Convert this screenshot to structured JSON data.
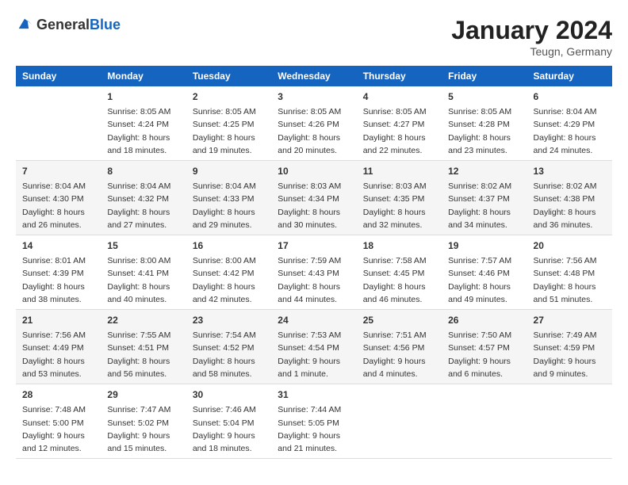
{
  "header": {
    "logo_general": "General",
    "logo_blue": "Blue",
    "title": "January 2024",
    "subtitle": "Teugn, Germany"
  },
  "calendar": {
    "days_of_week": [
      "Sunday",
      "Monday",
      "Tuesday",
      "Wednesday",
      "Thursday",
      "Friday",
      "Saturday"
    ],
    "weeks": [
      [
        {
          "day": "",
          "info": ""
        },
        {
          "day": "1",
          "info": "Sunrise: 8:05 AM\nSunset: 4:24 PM\nDaylight: 8 hours\nand 18 minutes."
        },
        {
          "day": "2",
          "info": "Sunrise: 8:05 AM\nSunset: 4:25 PM\nDaylight: 8 hours\nand 19 minutes."
        },
        {
          "day": "3",
          "info": "Sunrise: 8:05 AM\nSunset: 4:26 PM\nDaylight: 8 hours\nand 20 minutes."
        },
        {
          "day": "4",
          "info": "Sunrise: 8:05 AM\nSunset: 4:27 PM\nDaylight: 8 hours\nand 22 minutes."
        },
        {
          "day": "5",
          "info": "Sunrise: 8:05 AM\nSunset: 4:28 PM\nDaylight: 8 hours\nand 23 minutes."
        },
        {
          "day": "6",
          "info": "Sunrise: 8:04 AM\nSunset: 4:29 PM\nDaylight: 8 hours\nand 24 minutes."
        }
      ],
      [
        {
          "day": "7",
          "info": "Sunrise: 8:04 AM\nSunset: 4:30 PM\nDaylight: 8 hours\nand 26 minutes."
        },
        {
          "day": "8",
          "info": "Sunrise: 8:04 AM\nSunset: 4:32 PM\nDaylight: 8 hours\nand 27 minutes."
        },
        {
          "day": "9",
          "info": "Sunrise: 8:04 AM\nSunset: 4:33 PM\nDaylight: 8 hours\nand 29 minutes."
        },
        {
          "day": "10",
          "info": "Sunrise: 8:03 AM\nSunset: 4:34 PM\nDaylight: 8 hours\nand 30 minutes."
        },
        {
          "day": "11",
          "info": "Sunrise: 8:03 AM\nSunset: 4:35 PM\nDaylight: 8 hours\nand 32 minutes."
        },
        {
          "day": "12",
          "info": "Sunrise: 8:02 AM\nSunset: 4:37 PM\nDaylight: 8 hours\nand 34 minutes."
        },
        {
          "day": "13",
          "info": "Sunrise: 8:02 AM\nSunset: 4:38 PM\nDaylight: 8 hours\nand 36 minutes."
        }
      ],
      [
        {
          "day": "14",
          "info": "Sunrise: 8:01 AM\nSunset: 4:39 PM\nDaylight: 8 hours\nand 38 minutes."
        },
        {
          "day": "15",
          "info": "Sunrise: 8:00 AM\nSunset: 4:41 PM\nDaylight: 8 hours\nand 40 minutes."
        },
        {
          "day": "16",
          "info": "Sunrise: 8:00 AM\nSunset: 4:42 PM\nDaylight: 8 hours\nand 42 minutes."
        },
        {
          "day": "17",
          "info": "Sunrise: 7:59 AM\nSunset: 4:43 PM\nDaylight: 8 hours\nand 44 minutes."
        },
        {
          "day": "18",
          "info": "Sunrise: 7:58 AM\nSunset: 4:45 PM\nDaylight: 8 hours\nand 46 minutes."
        },
        {
          "day": "19",
          "info": "Sunrise: 7:57 AM\nSunset: 4:46 PM\nDaylight: 8 hours\nand 49 minutes."
        },
        {
          "day": "20",
          "info": "Sunrise: 7:56 AM\nSunset: 4:48 PM\nDaylight: 8 hours\nand 51 minutes."
        }
      ],
      [
        {
          "day": "21",
          "info": "Sunrise: 7:56 AM\nSunset: 4:49 PM\nDaylight: 8 hours\nand 53 minutes."
        },
        {
          "day": "22",
          "info": "Sunrise: 7:55 AM\nSunset: 4:51 PM\nDaylight: 8 hours\nand 56 minutes."
        },
        {
          "day": "23",
          "info": "Sunrise: 7:54 AM\nSunset: 4:52 PM\nDaylight: 8 hours\nand 58 minutes."
        },
        {
          "day": "24",
          "info": "Sunrise: 7:53 AM\nSunset: 4:54 PM\nDaylight: 9 hours\nand 1 minute."
        },
        {
          "day": "25",
          "info": "Sunrise: 7:51 AM\nSunset: 4:56 PM\nDaylight: 9 hours\nand 4 minutes."
        },
        {
          "day": "26",
          "info": "Sunrise: 7:50 AM\nSunset: 4:57 PM\nDaylight: 9 hours\nand 6 minutes."
        },
        {
          "day": "27",
          "info": "Sunrise: 7:49 AM\nSunset: 4:59 PM\nDaylight: 9 hours\nand 9 minutes."
        }
      ],
      [
        {
          "day": "28",
          "info": "Sunrise: 7:48 AM\nSunset: 5:00 PM\nDaylight: 9 hours\nand 12 minutes."
        },
        {
          "day": "29",
          "info": "Sunrise: 7:47 AM\nSunset: 5:02 PM\nDaylight: 9 hours\nand 15 minutes."
        },
        {
          "day": "30",
          "info": "Sunrise: 7:46 AM\nSunset: 5:04 PM\nDaylight: 9 hours\nand 18 minutes."
        },
        {
          "day": "31",
          "info": "Sunrise: 7:44 AM\nSunset: 5:05 PM\nDaylight: 9 hours\nand 21 minutes."
        },
        {
          "day": "",
          "info": ""
        },
        {
          "day": "",
          "info": ""
        },
        {
          "day": "",
          "info": ""
        }
      ]
    ]
  }
}
